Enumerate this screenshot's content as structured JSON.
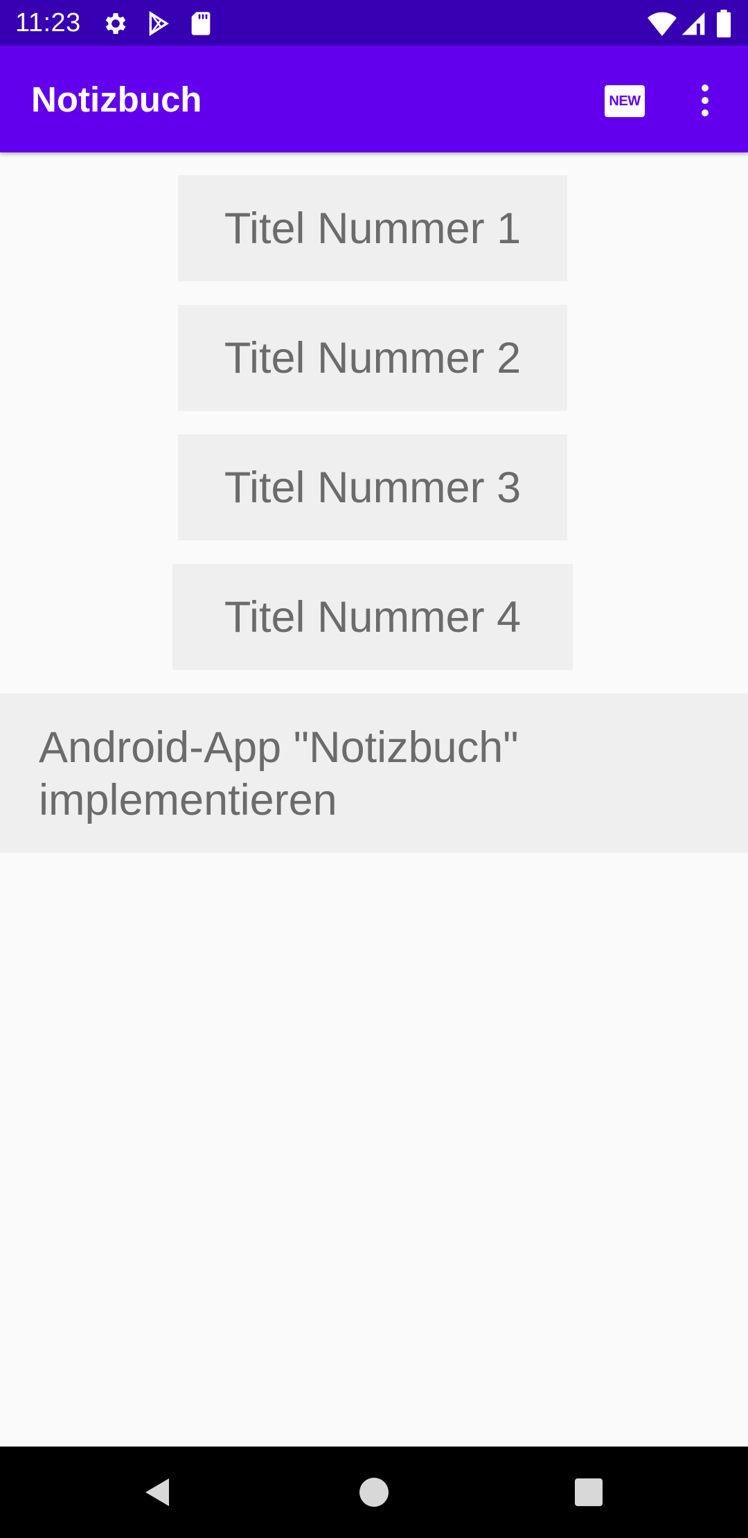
{
  "status_bar": {
    "time": "11:23",
    "icons": [
      "gear-icon",
      "play-store-icon",
      "sd-card-icon",
      "wifi-icon",
      "cell-signal-icon",
      "battery-icon"
    ]
  },
  "app_bar": {
    "title": "Notizbuch",
    "new_action_label": "NEW",
    "overflow_icon": "more-vert-icon"
  },
  "notes": {
    "titles": [
      "Titel Nummer 1",
      "Titel Nummer 2",
      "Titel Nummer 3",
      "Titel Nummer 4"
    ],
    "entry_text": "Android-App \"Notizbuch\" implementieren"
  },
  "nav_bar": {
    "icons": [
      "back-icon",
      "home-icon",
      "recents-icon"
    ]
  },
  "colors": {
    "status_bar": "#3700b3",
    "app_bar": "#6200ee",
    "background": "#fafafa",
    "button_bg": "#efefef",
    "button_text": "#6b6b6b",
    "nav_bar": "#000000"
  }
}
